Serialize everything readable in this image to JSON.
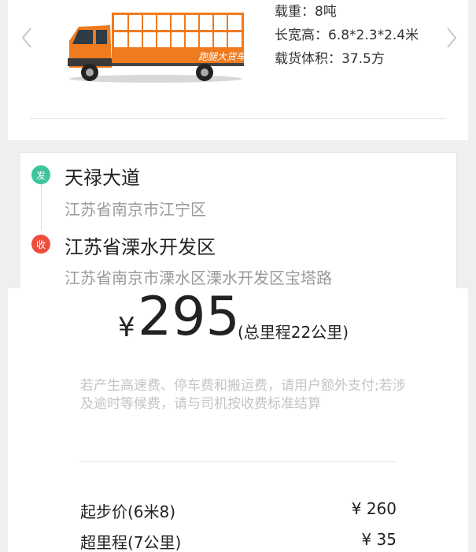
{
  "vehicle": {
    "specs": [
      {
        "label": "载重：",
        "value": "8吨"
      },
      {
        "label": "长宽高：",
        "value": "6.8*2.3*2.4米"
      },
      {
        "label": "载货体积：",
        "value": "37.5方"
      }
    ],
    "truck_brand_text": "跑腿大货车",
    "icons": {
      "prev": "chevron-left-icon",
      "next": "chevron-right-icon"
    }
  },
  "route": {
    "start": {
      "badge": "发",
      "title": "天禄大道",
      "subtitle": "江苏省南京市江宁区"
    },
    "end": {
      "badge": "收",
      "title": "江苏省溧水开发区",
      "subtitle": "江苏省南京市溧水区溧水开发区宝塔路"
    }
  },
  "price": {
    "currency": "¥",
    "amount": "295",
    "distance_note": "(总里程22公里)",
    "fee_note": "若产生高速费、停车费和搬运费，请用户额外支付;若涉及逾时等候费，请与司机按收费标准结算",
    "breakdown": [
      {
        "label": "起步价(6米8)",
        "value": "¥ 260"
      },
      {
        "label": "超里程(7公里)",
        "value": "¥ 35"
      }
    ]
  },
  "colors": {
    "start_badge": "#3cc49a",
    "end_badge": "#ee4d3e",
    "truck_orange": "#f07a1e"
  }
}
